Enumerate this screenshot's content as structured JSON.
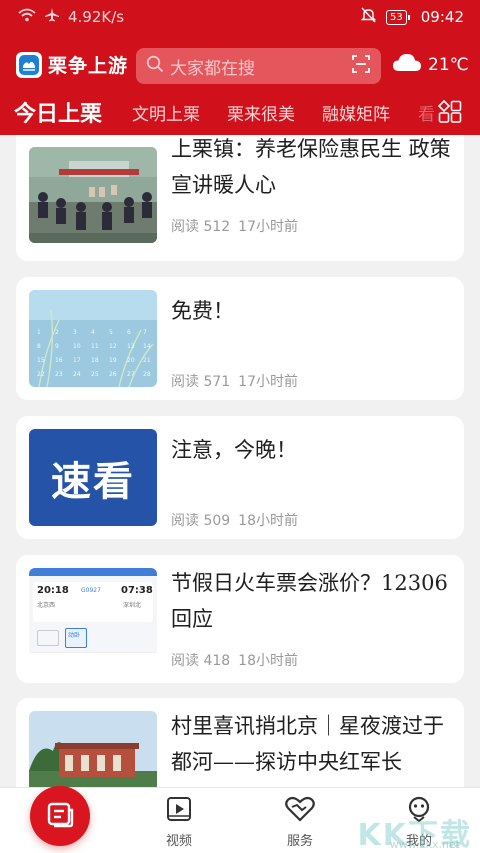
{
  "status_bar": {
    "net_speed": "4.92K/s",
    "battery": "53",
    "time": "09:42"
  },
  "header": {
    "app_name": "栗争上游",
    "search_placeholder": "大家都在搜",
    "weather_temp": "21℃"
  },
  "tabs": [
    {
      "label": "今日上栗",
      "active": true
    },
    {
      "label": "文明上栗",
      "active": false
    },
    {
      "label": "栗来很美",
      "active": false
    },
    {
      "label": "融媒矩阵",
      "active": false
    },
    {
      "label": "看",
      "active": false
    }
  ],
  "articles": [
    {
      "title": "上栗镇：养老保险惠民生 政策宣讲暖人心",
      "reads": "阅读 512",
      "time": "17小时前",
      "thumb": "photo-outdoor-meeting"
    },
    {
      "title": "免费！",
      "reads": "阅读 571",
      "time": "17小时前",
      "thumb": "calendar-reeds"
    },
    {
      "title": "注意，今晚！",
      "reads": "阅读 509",
      "time": "18小时前",
      "thumb": "quick-look-banner",
      "thumb_text": "速看"
    },
    {
      "title": "节假日火车票会涨价？12306回应",
      "reads": "阅读 418",
      "time": "18小时前",
      "thumb": "train-ticket-screenshot",
      "thumb_detail": {
        "from_time": "20:18",
        "to_time": "07:38",
        "from_station": "北京西",
        "to_station": "深圳北",
        "train_no": "G0927",
        "seat_label": "动卧"
      }
    },
    {
      "title": "村里喜讯捎北京｜星夜渡过于都河——探访中央红军长",
      "reads": "",
      "time": "",
      "thumb": "photo-memorial-hall"
    }
  ],
  "bottom_nav": [
    {
      "label": "",
      "icon": "news-icon",
      "active": true
    },
    {
      "label": "视频",
      "icon": "video-icon"
    },
    {
      "label": "服务",
      "icon": "heart-hands-icon"
    },
    {
      "label": "我的",
      "icon": "profile-icon"
    }
  ],
  "watermark": {
    "text": "KK下载",
    "url": "www.kkx.net"
  },
  "colors": {
    "brand_red": "#d0111b",
    "search_bg": "#e4555c",
    "page_bg": "#f1f1f1",
    "meta_gray": "#9a9a9a"
  }
}
